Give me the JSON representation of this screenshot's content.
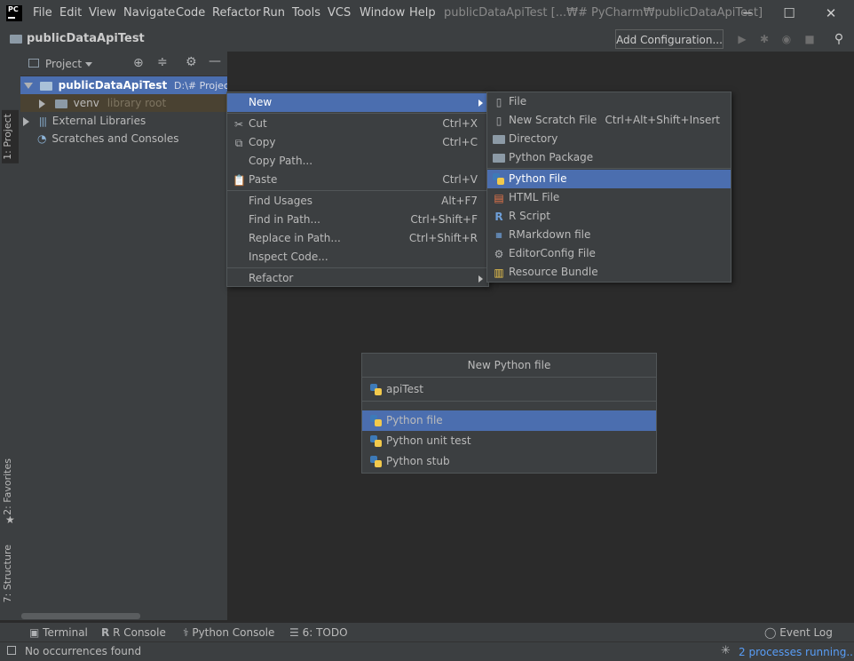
{
  "titlebar": {
    "logo": "PC",
    "menus": [
      "File",
      "Edit",
      "View",
      "Navigate",
      "Code",
      "Refactor",
      "Run",
      "Tools",
      "VCS",
      "Window",
      "Help"
    ],
    "window_title": "publicDataApiTest [...₩# PyCharm₩publicDataApiTest]"
  },
  "navbar": {
    "project_name": "publicDataApiTest",
    "add_config": "Add Configuration..."
  },
  "left_stripe": {
    "project_tab": "1: Project",
    "favorites_tab": "2: Favorites",
    "structure_tab": "7: Structure"
  },
  "project_panel": {
    "header": "Project",
    "tree": {
      "root_name": "publicDataApiTest",
      "root_path": "D:\\# Project\\#",
      "venv": "venv",
      "venv_hint": "library root",
      "external": "External Libraries",
      "scratches": "Scratches and Consoles"
    }
  },
  "context_menu": {
    "items": [
      {
        "label": "New",
        "shortcut": ""
      },
      {
        "label": "Cut",
        "shortcut": "Ctrl+X"
      },
      {
        "label": "Copy",
        "shortcut": "Ctrl+C"
      },
      {
        "label": "Copy Path...",
        "shortcut": ""
      },
      {
        "label": "Paste",
        "shortcut": "Ctrl+V"
      },
      {
        "label": "Find Usages",
        "shortcut": "Alt+F7"
      },
      {
        "label": "Find in Path...",
        "shortcut": "Ctrl+Shift+F"
      },
      {
        "label": "Replace in Path...",
        "shortcut": "Ctrl+Shift+R"
      },
      {
        "label": "Inspect Code...",
        "shortcut": ""
      },
      {
        "label": "Refactor",
        "shortcut": ""
      }
    ]
  },
  "submenu": {
    "items": [
      {
        "label": "File",
        "shortcut": ""
      },
      {
        "label": "New Scratch File",
        "shortcut": "Ctrl+Alt+Shift+Insert"
      },
      {
        "label": "Directory",
        "shortcut": ""
      },
      {
        "label": "Python Package",
        "shortcut": ""
      },
      {
        "label": "Python File",
        "shortcut": ""
      },
      {
        "label": "HTML File",
        "shortcut": ""
      },
      {
        "label": "R Script",
        "shortcut": ""
      },
      {
        "label": "RMarkdown file",
        "shortcut": ""
      },
      {
        "label": "EditorConfig File",
        "shortcut": ""
      },
      {
        "label": "Resource Bundle",
        "shortcut": ""
      }
    ]
  },
  "new_python_file": {
    "title": "New Python file",
    "input_value": "apiTest",
    "options": [
      "Python file",
      "Python unit test",
      "Python stub"
    ]
  },
  "bottom_tools": {
    "terminal": "Terminal",
    "r_console": "R Console",
    "python_console": "Python Console",
    "todo": "6: TODO",
    "event_log": "Event Log"
  },
  "status": {
    "message": "No occurrences found",
    "processes": "2 processes running..."
  },
  "colors": {
    "selection": "#4b6eaf",
    "panel": "#3c3f41",
    "editor": "#2b2b2b",
    "link": "#589df6"
  }
}
